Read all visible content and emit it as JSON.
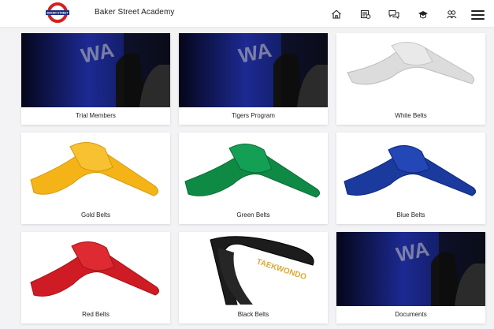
{
  "header": {
    "logo_text": "BAKER STREET",
    "title": "Baker Street Academy",
    "nav": [
      {
        "name": "home-icon"
      },
      {
        "name": "schedule-icon"
      },
      {
        "name": "messages-icon"
      },
      {
        "name": "classes-icon"
      },
      {
        "name": "members-icon"
      }
    ],
    "menu_icon": "hamburger-menu-icon"
  },
  "cards": [
    {
      "label": "Trial Members",
      "image": "promo-banner",
      "color": "#0e1a72"
    },
    {
      "label": "Tigers Program",
      "image": "promo-banner",
      "color": "#0e1a72"
    },
    {
      "label": "White Belts",
      "image": "belt",
      "color": "#e6e6e6"
    },
    {
      "label": "Gold Belts",
      "image": "belt",
      "color": "#f4b417"
    },
    {
      "label": "Green Belts",
      "image": "belt",
      "color": "#0f8a45"
    },
    {
      "label": "Blue Belts",
      "image": "belt",
      "color": "#1b3a9e"
    },
    {
      "label": "Red Belts",
      "image": "belt",
      "color": "#cf1c24"
    },
    {
      "label": "Black Belts",
      "image": "black-belt",
      "color": "#1c1c1c"
    },
    {
      "label": "Documents",
      "image": "promo-banner",
      "color": "#0e1a72"
    }
  ]
}
